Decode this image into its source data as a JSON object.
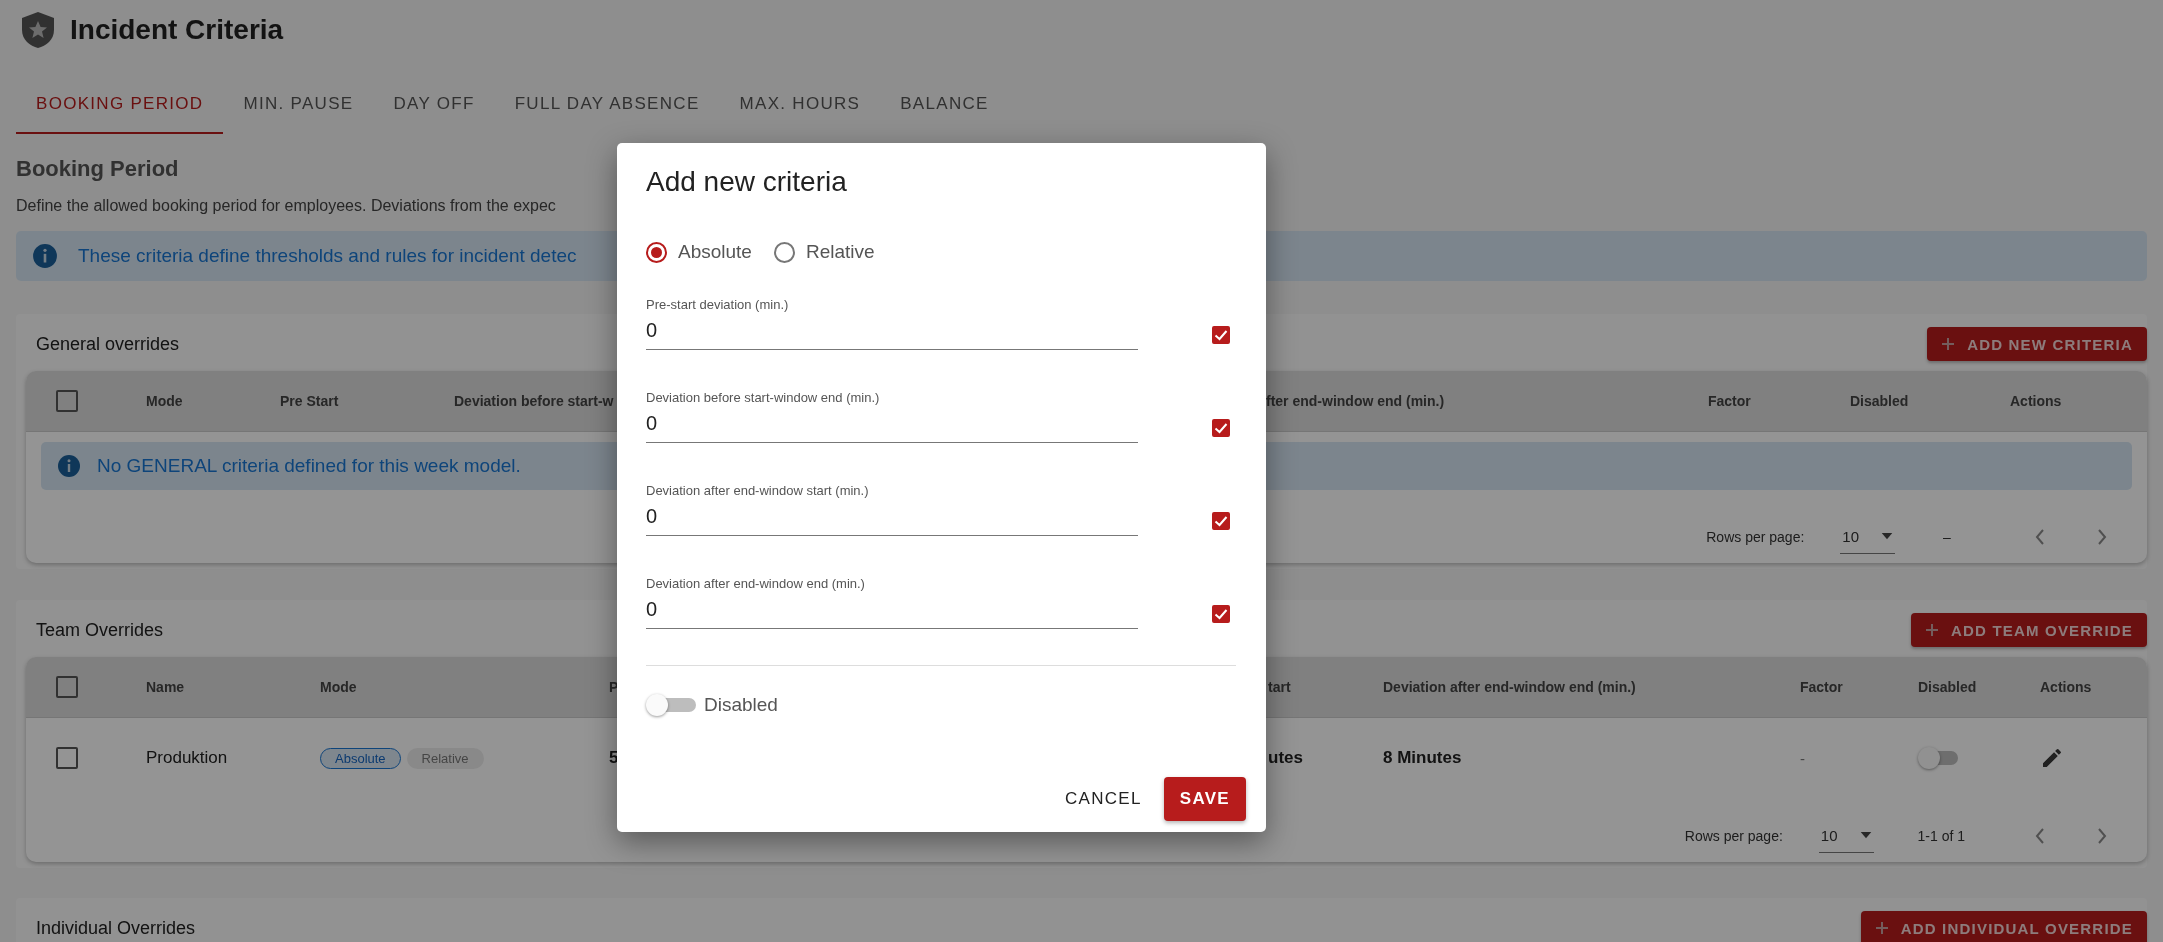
{
  "header": {
    "title": "Incident Criteria"
  },
  "tabs": [
    {
      "label": "BOOKING PERIOD",
      "selected": true
    },
    {
      "label": "MIN. PAUSE",
      "selected": false
    },
    {
      "label": "DAY OFF",
      "selected": false
    },
    {
      "label": "FULL DAY ABSENCE",
      "selected": false
    },
    {
      "label": "MAX. HOURS",
      "selected": false
    },
    {
      "label": "BALANCE",
      "selected": false
    }
  ],
  "section": {
    "title": "Booking Period",
    "description": "Define the allowed booking period for employees. Deviations from the expec",
    "info": "These criteria define thresholds and rules for incident detec"
  },
  "general_overrides": {
    "title": "General overrides",
    "button": "ADD NEW CRITERIA",
    "all_selected": false,
    "columns": [
      "Mode",
      "Pre Start",
      "Deviation before start-w",
      "fter end-window end (min.)",
      "Factor",
      "Disabled",
      "Actions"
    ],
    "empty_message": "No GENERAL criteria defined for this week model.",
    "pagination": {
      "rows_per_page_label": "Rows per page:",
      "rows_per_page": "10",
      "range": "–"
    }
  },
  "team_overrides": {
    "title": "Team Overrides",
    "button": "ADD TEAM OVERRIDE",
    "all_selected": false,
    "columns": [
      "Name",
      "Mode",
      "P",
      "tart",
      "Deviation after end-window end (min.)",
      "Factor",
      "Disabled",
      "Actions"
    ],
    "rows": [
      {
        "selected": false,
        "name": "Produktion",
        "modes": [
          {
            "label": "Absolute",
            "selected": true
          },
          {
            "label": "Relative",
            "selected": false
          }
        ],
        "column_3": "5",
        "column_4": "utes",
        "deviation_after_end_window_end": "8 Minutes",
        "factor": "-",
        "disabled": false
      }
    ],
    "pagination": {
      "rows_per_page_label": "Rows per page:",
      "rows_per_page": "10",
      "range": "1-1 of 1"
    }
  },
  "individual_overrides": {
    "title": "Individual Overrides",
    "button": "ADD INDIVIDUAL OVERRIDE"
  },
  "dialog": {
    "title": "Add new criteria",
    "modes": [
      {
        "label": "Absolute",
        "selected": true
      },
      {
        "label": "Relative",
        "selected": false
      }
    ],
    "fields": [
      {
        "label": "Pre-start deviation (min.)",
        "value": "0",
        "checked": true
      },
      {
        "label": "Deviation before start-window end (min.)",
        "value": "0",
        "checked": true
      },
      {
        "label": "Deviation after end-window start (min.)",
        "value": "0",
        "checked": true
      },
      {
        "label": "Deviation after end-window end (min.)",
        "value": "0",
        "checked": true
      }
    ],
    "disabled_toggle": {
      "label": "Disabled",
      "on": false
    },
    "buttons": {
      "cancel": "CANCEL",
      "save": "SAVE"
    }
  }
}
